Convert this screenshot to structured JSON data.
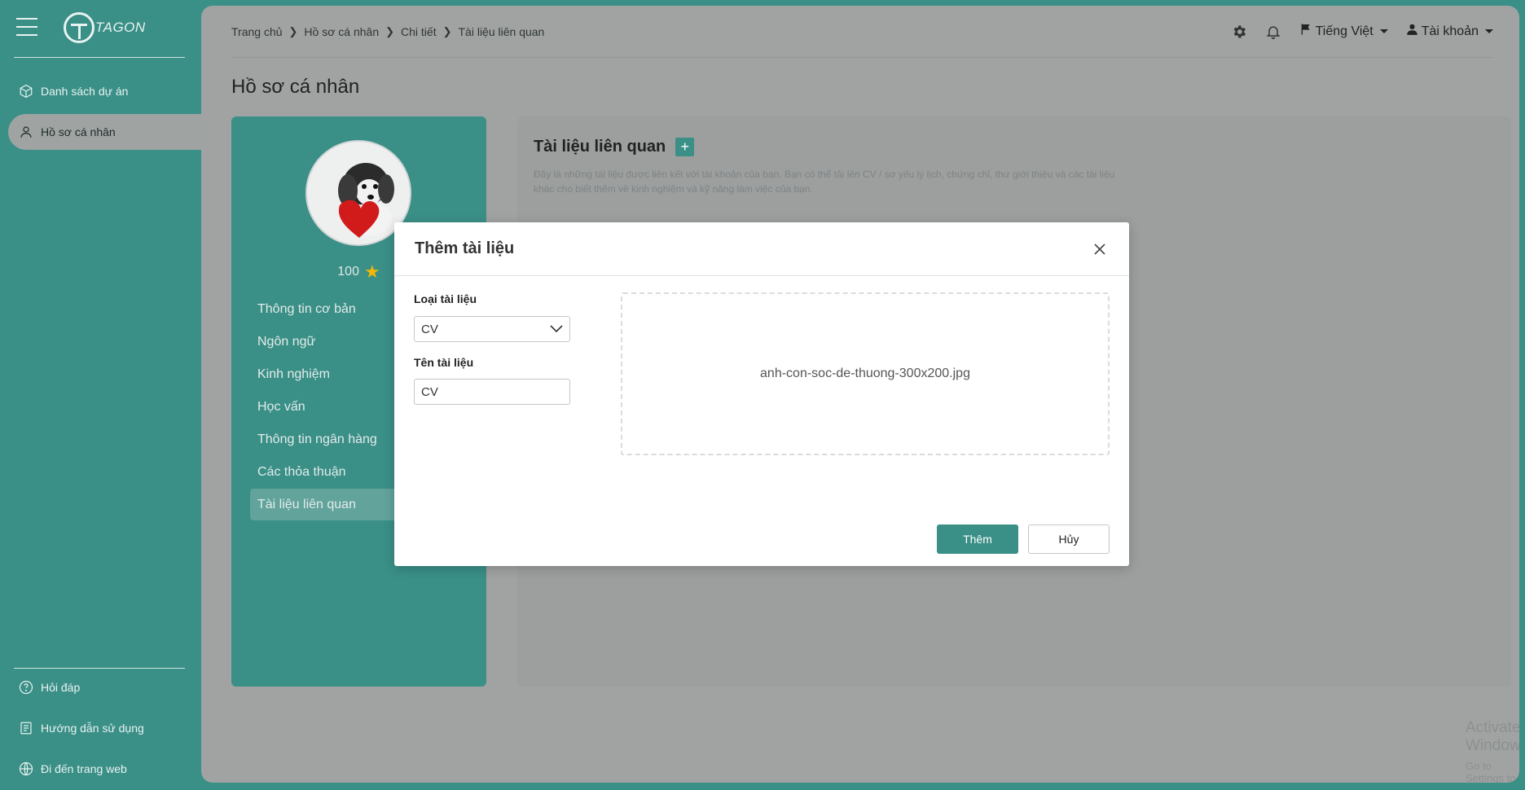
{
  "sidebar": {
    "logo_text": "TAGON",
    "nav": [
      {
        "label": "Danh sách dự án",
        "icon": "cube-icon"
      },
      {
        "label": "Hồ sơ cá nhân",
        "icon": "user-icon"
      }
    ],
    "footer": [
      {
        "label": "Hỏi đáp",
        "icon": "help-circle-icon"
      },
      {
        "label": "Hướng dẫn sử dụng",
        "icon": "document-icon"
      },
      {
        "label": "Đi đến trang web",
        "icon": "globe-icon"
      }
    ]
  },
  "header": {
    "breadcrumb": [
      "Trang chủ",
      "Hồ sơ cá nhân",
      "Chi tiết",
      "Tài liệu liên quan"
    ],
    "language": "Tiếng Việt",
    "account": "Tài khoản"
  },
  "page": {
    "title": "Hồ sơ cá nhân"
  },
  "profile": {
    "points": "100",
    "menu": [
      "Thông tin cơ bản",
      "Ngôn ngữ",
      "Kinh nghiệm",
      "Học vấn",
      "Thông tin ngân hàng",
      "Các thỏa thuận",
      "Tài liệu liên quan"
    ],
    "active_index": 6
  },
  "documents": {
    "title": "Tài liệu liên quan",
    "add_symbol": "+",
    "description": "Đây là những tài liệu được liên kết với tài khoản của bạn. Bạn có thể tải lên CV / sơ yếu lý lịch, chứng chỉ, thư giới thiệu và các tài liệu khác cho biết thêm về kinh nghiệm và kỹ năng làm việc của bạn."
  },
  "modal": {
    "title": "Thêm tài liệu",
    "type_label": "Loại tài liệu",
    "type_value": "CV",
    "name_label": "Tên tài liệu",
    "name_value": "CV",
    "file_name": "anh-con-soc-de-thuong-300x200.jpg",
    "submit": "Thêm",
    "cancel": "Hủy"
  },
  "watermark": {
    "line1": "Activate Windows",
    "line2": "Go to Settings to activate Windows."
  },
  "colors": {
    "brand": "#3a8f87",
    "accent_star": "#f2b705"
  }
}
